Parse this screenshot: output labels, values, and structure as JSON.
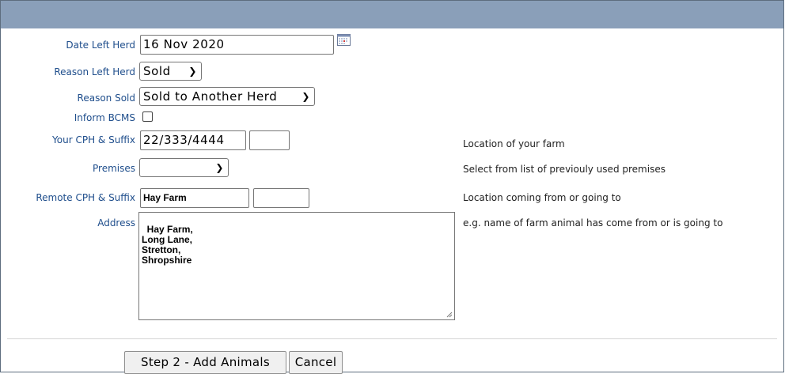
{
  "form": {
    "date_left_herd": {
      "label": "Date Left Herd",
      "value": "16 Nov 2020"
    },
    "reason_left_herd": {
      "label": "Reason Left Herd",
      "value": "Sold"
    },
    "reason_sold": {
      "label": "Reason Sold",
      "value": "Sold to Another Herd"
    },
    "inform_bcms": {
      "label": "Inform BCMS",
      "checked": false
    },
    "your_cph": {
      "label": "Your CPH & Suffix",
      "value": "22/333/4444",
      "suffix": "",
      "hint": "Location of your farm"
    },
    "premises": {
      "label": "Premises",
      "value": "",
      "hint": "Select from list of previouly used premises"
    },
    "remote_cph": {
      "label": "Remote CPH & Suffix",
      "value": "Hay Farm",
      "suffix": "",
      "hint": "Location coming from or going to"
    },
    "address": {
      "label": "Address",
      "value": "Hay Farm,\nLong Lane,\nStretton,\nShropshire",
      "hint": "e.g. name of farm animal has come from or is going to"
    }
  },
  "buttons": {
    "next_label": "Step 2 - Add Animals",
    "cancel_label": "Cancel"
  },
  "icons": {
    "calendar": "calendar-icon",
    "dropdown": "chevron-down-icon"
  },
  "colors": {
    "header_bar": "#8a9fb9",
    "label_text": "#1f4e8c"
  }
}
